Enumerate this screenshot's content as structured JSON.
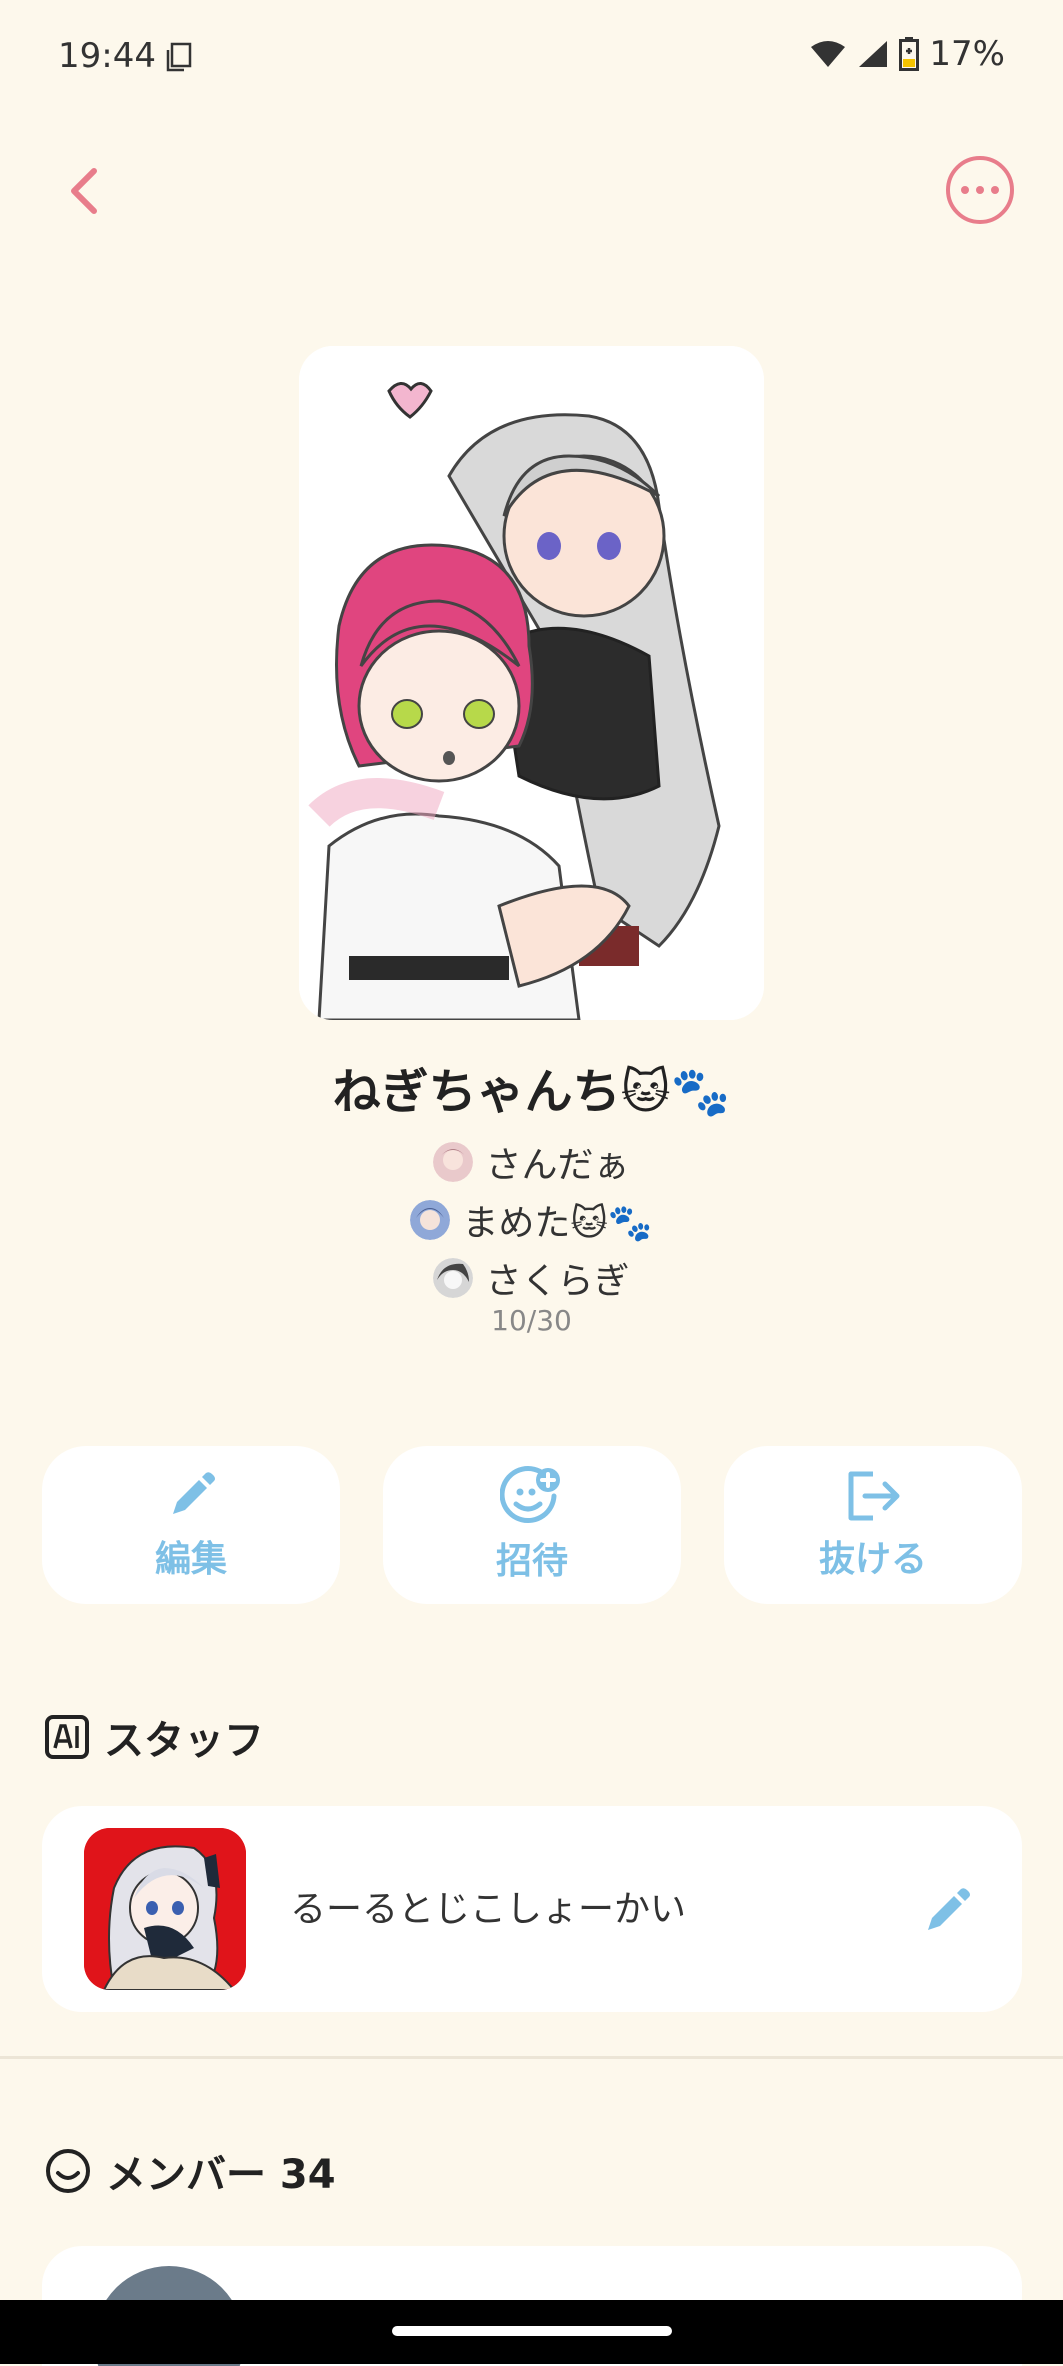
{
  "status_bar": {
    "time": "19:44",
    "battery": "17%"
  },
  "group": {
    "name": "ねぎちゃんち🐱🐾",
    "admins": [
      {
        "name": "さんだぁ"
      },
      {
        "name": "まめた🐱🐾"
      },
      {
        "name": "さくらぎ"
      }
    ],
    "member_count": "10/30"
  },
  "actions": {
    "edit_label": "編集",
    "invite_label": "招待",
    "leave_label": "抜ける"
  },
  "staff": {
    "title": "スタッフ",
    "item_name": "るーるとじこしょーかい"
  },
  "members": {
    "title": "メンバー 34"
  },
  "colors": {
    "accent_pink": "#e87d8b",
    "accent_blue": "#7ec0e6",
    "background": "#fdf8ec"
  }
}
